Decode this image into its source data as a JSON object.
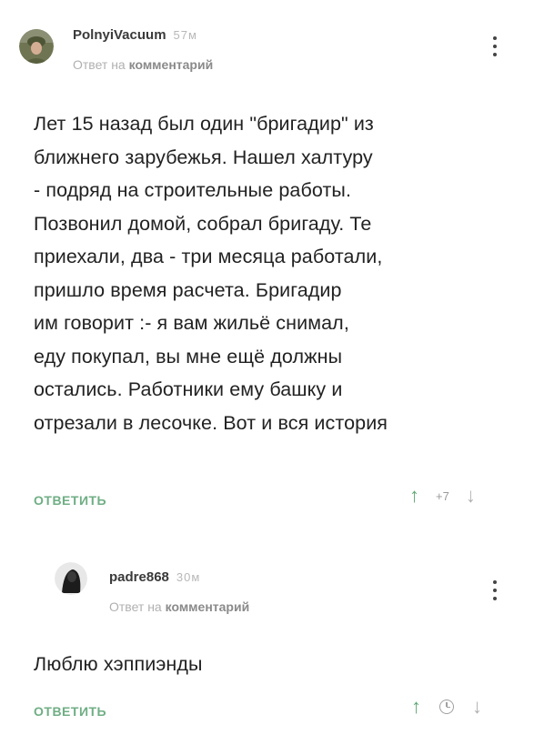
{
  "comments": [
    {
      "author": "PolnyiVacuum",
      "time": "57м",
      "reply_prefix": "Ответ на",
      "reply_link": "комментарий",
      "text": "Лет 15 назад был один \"бригадир\" из\nближнего зарубежья. Нашел халтуру\n- подряд на строительные работы.\nПозвонил домой, собрал бригаду. Те\nприехали, два - три месяца работали,\nпришло время расчета. Бригадир\nим говорит :- я вам жильё снимал,\nеду покупал, вы мне ещё должны\nостались. Работники ему башку и\nотрезали в лесочке. Вот и вся история",
      "reply_button": "ОТВЕТИТЬ",
      "rating": "+7"
    },
    {
      "author": "padre868",
      "time": "30м",
      "reply_prefix": "Ответ на",
      "reply_link": "комментарий",
      "text": "Люблю хэппиэнды",
      "reply_button": "ОТВЕТИТЬ"
    }
  ],
  "icons": {
    "upvote": "arrow-up-icon",
    "downvote": "arrow-down-icon",
    "menu": "more-vertical-icon",
    "pending": "clock-icon"
  },
  "colors": {
    "accent": "#6fae84",
    "upvote": "#5fa874",
    "muted": "#b0b0b0"
  }
}
